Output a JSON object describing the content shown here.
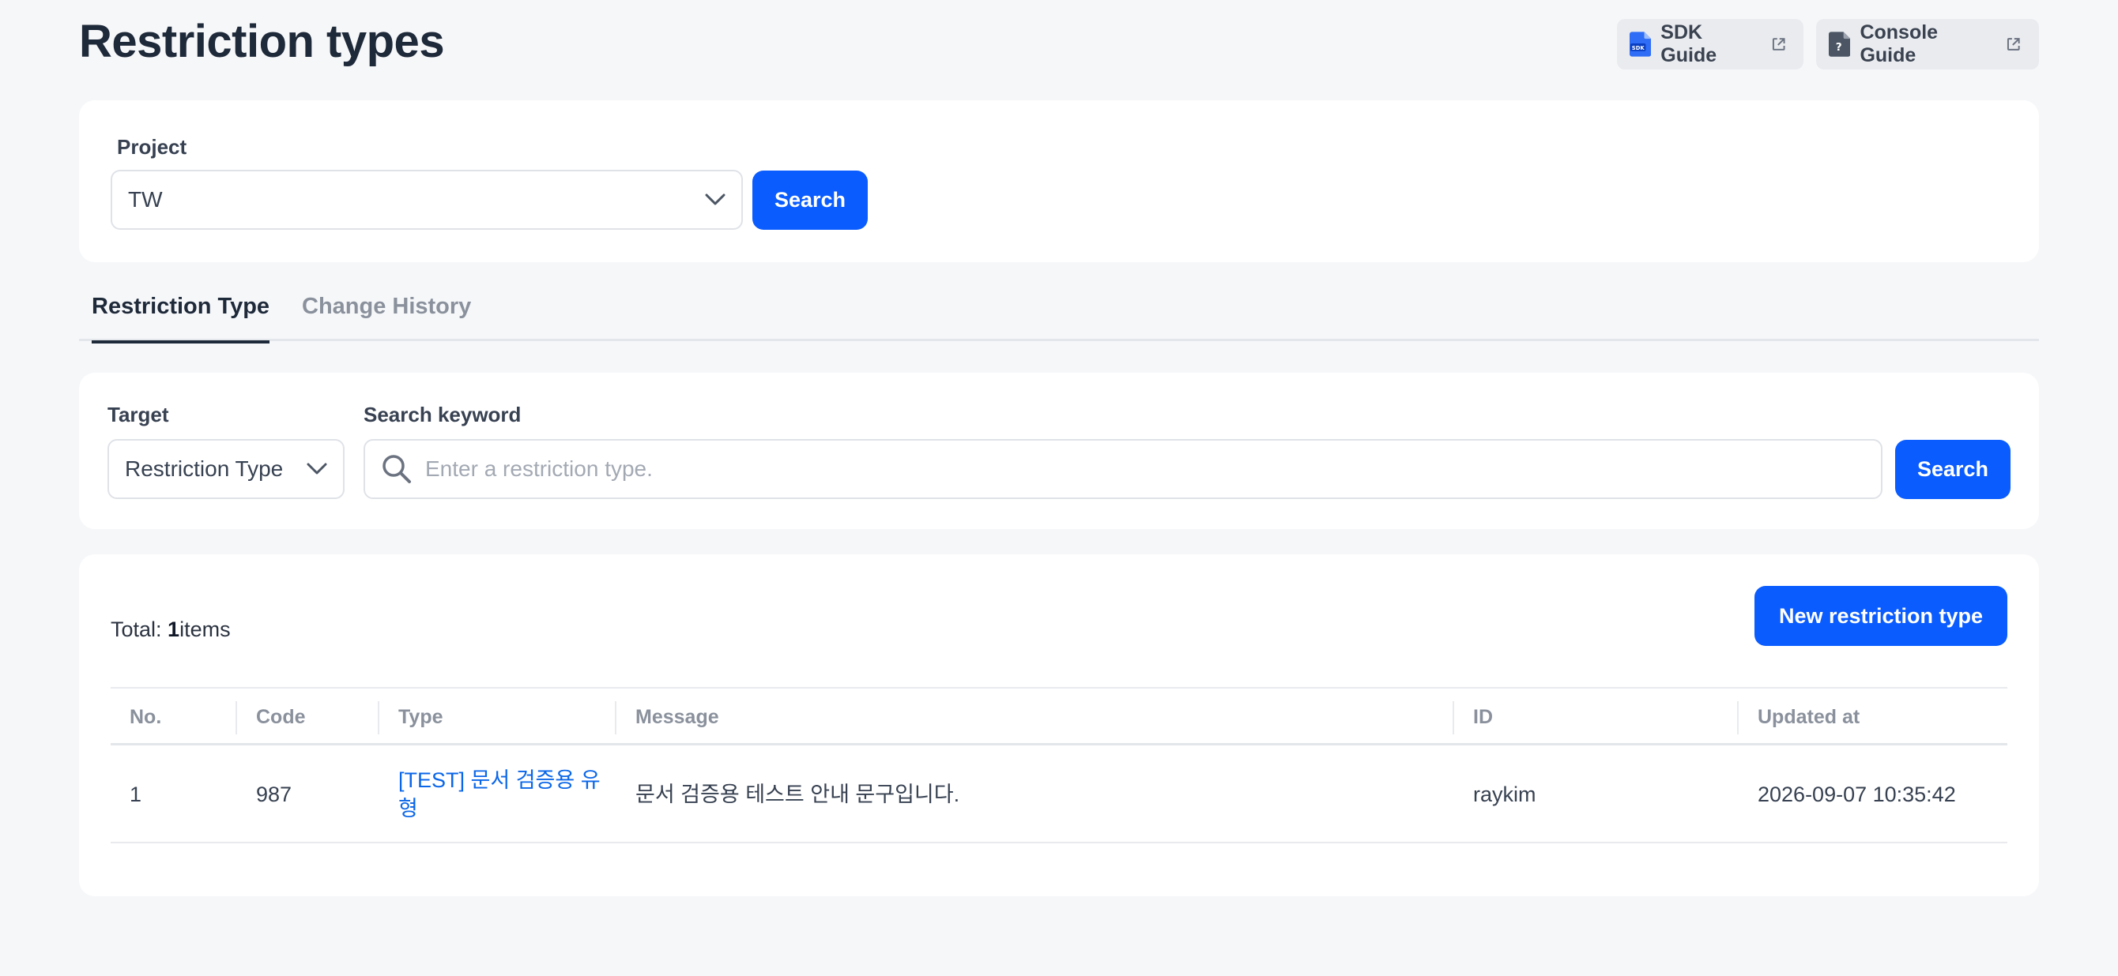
{
  "header": {
    "title": "Restriction types",
    "sdk_guide": "SDK Guide",
    "console_guide": "Console Guide"
  },
  "project": {
    "label": "Project",
    "selected": "TW",
    "search_label": "Search"
  },
  "tabs": [
    {
      "label": "Restriction Type",
      "active": true
    },
    {
      "label": "Change History",
      "active": false
    }
  ],
  "filter": {
    "target_label": "Target",
    "target_selected": "Restriction Type",
    "keyword_label": "Search keyword",
    "keyword_placeholder": "Enter a restriction type.",
    "search_label": "Search"
  },
  "results": {
    "total_prefix": "Total: ",
    "total_count": "1",
    "total_suffix": "items",
    "new_button": "New restriction type",
    "columns": [
      "No.",
      "Code",
      "Type",
      "Message",
      "ID",
      "Updated at"
    ],
    "rows": [
      {
        "no": "1",
        "code": "987",
        "type": "[TEST] 문서 검증용 유형",
        "message": "문서 검증용 테스트 안내 문구입니다.",
        "id": "raykim",
        "updated_at": "2026-09-07 10:35:42"
      }
    ]
  },
  "colors": {
    "primary": "#0a5cff",
    "link": "#0a66e8",
    "background": "#f6f7f9"
  }
}
